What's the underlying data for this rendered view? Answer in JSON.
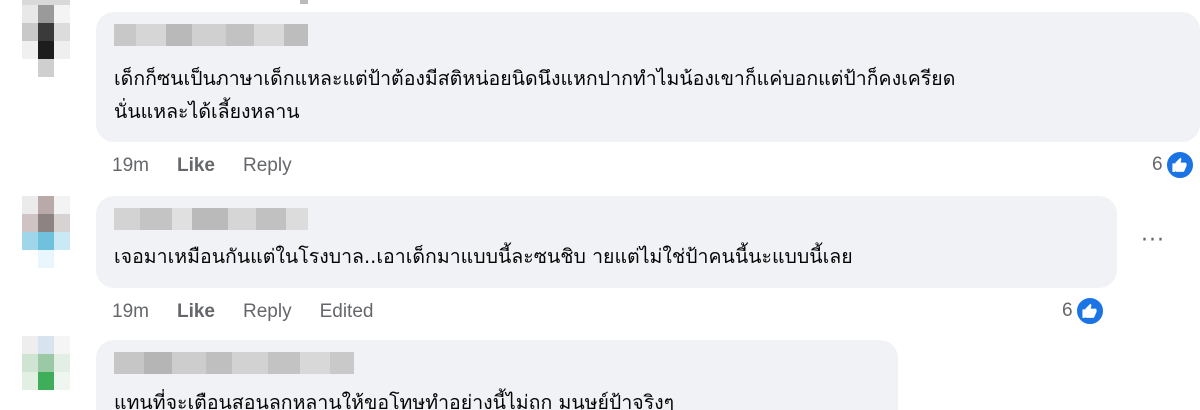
{
  "comments": [
    {
      "text_lines": [
        "เด็กก็ซนเป็นภาษาเด็กแหละแต่ป้าต้องมีสติหน่อยนิดนึงแหกปากทำไมน้องเขาก็แค่บอกแต่ป้าก็คงเครียด",
        "นั่นแหละได้เลี้ยงหลาน"
      ],
      "time": "19m",
      "like_label": "Like",
      "reply_label": "Reply",
      "reaction_count": "6",
      "reaction_icon": "like-icon"
    },
    {
      "text_lines": [
        "เจอมาเหมือนกันแต่ในโรงบาล..เอาเด็กมาแบบนี้ละซนชิบ  ายแต่ไม่ใช่ป้าคนนี้นะแบบนี้เลย"
      ],
      "time": "19m",
      "like_label": "Like",
      "reply_label": "Reply",
      "edited_label": "Edited",
      "reaction_count": "6",
      "reaction_icon": "like-icon",
      "more_label": "···"
    },
    {
      "text_lines": [
        "แทนที่จะเตือนสอนลูกหลานให้ขอโทษทำอย่างนี้ไม่ถูก มนุษย์ป้าจริงๆ"
      ]
    }
  ],
  "colors": {
    "bubble": "#f0f2f5",
    "meta": "#65676b",
    "like_blue": "#1b74e4"
  }
}
